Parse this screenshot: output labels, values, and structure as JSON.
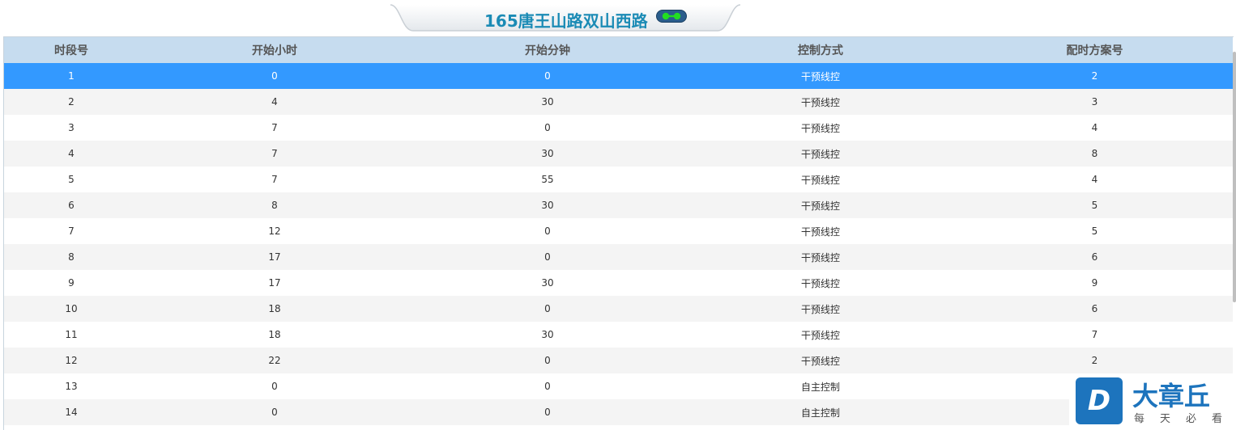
{
  "header": {
    "title": "165唐王山路双山西路",
    "status_icon": "link-status-icon",
    "status_color": "#22cc22"
  },
  "table": {
    "columns": [
      "时段号",
      "开始小时",
      "开始分钟",
      "控制方式",
      "配时方案号"
    ],
    "selected_row": 0,
    "selected_color": "#3399ff",
    "header_color": "#c6dcef",
    "rows": [
      [
        "1",
        "0",
        "0",
        "干预线控",
        "2"
      ],
      [
        "2",
        "4",
        "30",
        "干预线控",
        "3"
      ],
      [
        "3",
        "7",
        "0",
        "干预线控",
        "4"
      ],
      [
        "4",
        "7",
        "30",
        "干预线控",
        "8"
      ],
      [
        "5",
        "7",
        "55",
        "干预线控",
        "4"
      ],
      [
        "6",
        "8",
        "30",
        "干预线控",
        "5"
      ],
      [
        "7",
        "12",
        "0",
        "干预线控",
        "5"
      ],
      [
        "8",
        "17",
        "0",
        "干预线控",
        "6"
      ],
      [
        "9",
        "17",
        "30",
        "干预线控",
        "9"
      ],
      [
        "10",
        "18",
        "0",
        "干预线控",
        "6"
      ],
      [
        "11",
        "18",
        "30",
        "干预线控",
        "7"
      ],
      [
        "12",
        "22",
        "0",
        "干预线控",
        "2"
      ],
      [
        "13",
        "0",
        "0",
        "自主控制",
        ""
      ],
      [
        "14",
        "0",
        "0",
        "自主控制",
        ""
      ]
    ]
  },
  "watermark": {
    "logo_letter": "D",
    "brand": "大章丘",
    "slogan": "每天必看",
    "brand_color": "#1d74bd"
  }
}
